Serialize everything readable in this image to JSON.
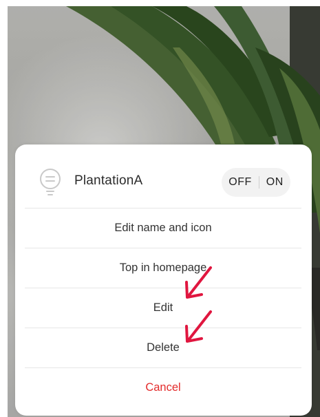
{
  "device": {
    "name": "PlantationA",
    "icon": "bulb-icon"
  },
  "toggle": {
    "off_label": "OFF",
    "on_label": "ON"
  },
  "menu": {
    "items": [
      {
        "label": "Edit name and icon"
      },
      {
        "label": "Top in homepage"
      },
      {
        "label": "Edit"
      },
      {
        "label": "Delete"
      }
    ],
    "cancel_label": "Cancel"
  },
  "annotations": {
    "arrow_color": "#e0163f",
    "arrows": [
      "arrow-to-edit",
      "arrow-to-delete"
    ]
  },
  "colors": {
    "cancel": "#e32b2b",
    "sheet_background": "#ffffff",
    "toggle_background": "#f2f2f2"
  }
}
